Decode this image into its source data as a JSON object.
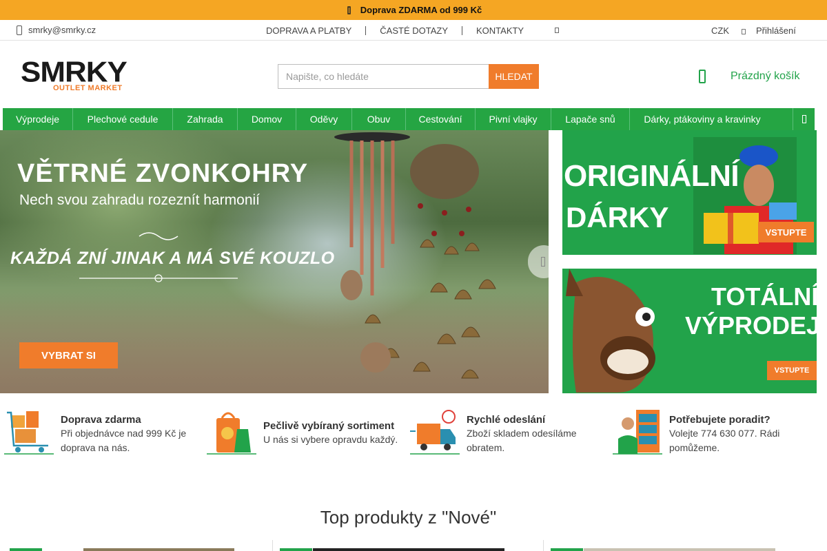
{
  "promo": {
    "text": "Doprava ZDARMA od 999 Kč"
  },
  "utility": {
    "email": "smrky@smrky.cz",
    "links": [
      "DOPRAVA A PLATBY",
      "ČASTÉ DOTAZY",
      "KONTAKTY"
    ],
    "currency": "CZK",
    "login": "Přihlášení"
  },
  "header": {
    "logo_main": "SMRKY",
    "logo_sub": "OUTLET MARKET",
    "search_placeholder": "Napište, co hledáte",
    "search_button": "HLEDAT",
    "cart_label": "Prázdný košík"
  },
  "nav": {
    "items": [
      "Výprodeje",
      "Plechové cedule",
      "Zahrada",
      "Domov",
      "Oděvy",
      "Obuv",
      "Cestování",
      "Pivní vlajky",
      "Lapače snů",
      "Dárky, ptákoviny a kravinky"
    ]
  },
  "hero": {
    "title": "VĚTRNÉ ZVONKOHRY",
    "subtitle": "Nech svou zahradu rozeznít harmonií",
    "tagline": "KAŽDÁ ZNÍ JINAK A MÁ SVÉ KOUZLO",
    "cta": "VYBRAT SI"
  },
  "banners": [
    {
      "line1": "ORIGINÁLNÍ",
      "line2": "DÁRKY",
      "cta": "VSTUPTE"
    },
    {
      "line1": "TOTÁLNÍ",
      "line2": "VÝPRODEJ",
      "cta": "VSTUPTE"
    }
  ],
  "benefits": [
    {
      "title": "Doprava zdarma",
      "desc1": "Při objednávce nad 999 Kč je",
      "desc2": "doprava na nás."
    },
    {
      "title": "Pečlivě vybíraný sortiment",
      "desc1": "U nás si vybere opravdu každý.",
      "desc2": ""
    },
    {
      "title": "Rychlé odeslání",
      "desc1": "Zboží skladem odesíláme",
      "desc2": "obratem."
    },
    {
      "title": "Potřebujete poradit?",
      "desc1": "Volejte 774 630 077. Rádi",
      "desc2": "pomůžeme."
    }
  ],
  "products_section": {
    "title": "Top produkty z \"Nové\""
  },
  "colors": {
    "accent_orange": "#f07c2b",
    "brand_green": "#25a543",
    "promo_yellow": "#f5a623"
  }
}
